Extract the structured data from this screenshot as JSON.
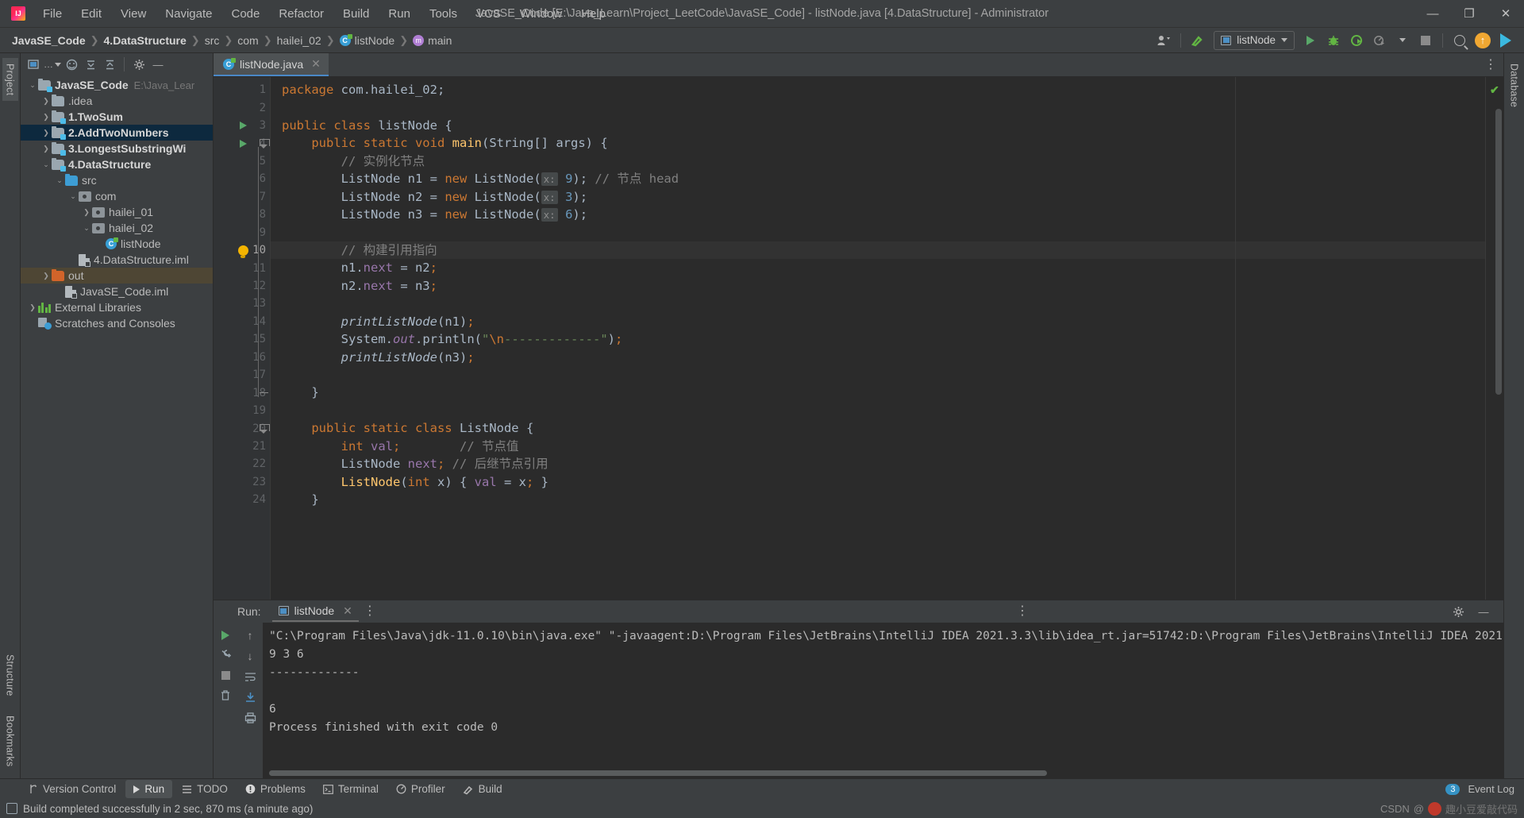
{
  "window": {
    "title": "JavaSE_Code [E:\\Java_Learn\\Project_LeetCode\\JavaSE_Code] - listNode.java [4.DataStructure] - Administrator",
    "minimize": "—",
    "maximize": "❐",
    "close": "✕"
  },
  "menu": [
    "File",
    "Edit",
    "View",
    "Navigate",
    "Code",
    "Refactor",
    "Build",
    "Run",
    "Tools",
    "VCS",
    "Window",
    "Help"
  ],
  "breadcrumbs": [
    {
      "label": "JavaSE_Code",
      "bold": true,
      "icon": ""
    },
    {
      "label": "4.DataStructure",
      "bold": true,
      "icon": ""
    },
    {
      "label": "src",
      "bold": false,
      "icon": ""
    },
    {
      "label": "com",
      "bold": false,
      "icon": ""
    },
    {
      "label": "hailei_02",
      "bold": false,
      "icon": ""
    },
    {
      "label": "listNode",
      "bold": false,
      "icon": "class-icon"
    },
    {
      "label": "main",
      "bold": false,
      "icon": "method-icon"
    }
  ],
  "toolbar": {
    "run_config": "listNode",
    "run_tooltip": "Run",
    "debug_tooltip": "Debug",
    "coverage_tooltip": "Run with Coverage",
    "profile_tooltip": "Profiler",
    "stop_tooltip": "Stop",
    "search_tooltip": "Search Everywhere",
    "update_tooltip": "Update Project"
  },
  "project_panel": {
    "title": "Project",
    "tree": [
      {
        "indent": 0,
        "arrow": "v",
        "icon": "module-folder-icon",
        "label": "JavaSE_Code",
        "bold": true,
        "path": "E:\\Java_Lear",
        "state": "normal"
      },
      {
        "indent": 1,
        "arrow": ">",
        "icon": "folder-icon",
        "label": ".idea",
        "bold": false,
        "path": "",
        "state": "normal"
      },
      {
        "indent": 1,
        "arrow": ">",
        "icon": "module-folder-icon",
        "label": "1.TwoSum",
        "bold": true,
        "path": "",
        "state": "normal"
      },
      {
        "indent": 1,
        "arrow": ">",
        "icon": "module-folder-icon",
        "label": "2.AddTwoNumbers",
        "bold": true,
        "path": "",
        "state": "selected"
      },
      {
        "indent": 1,
        "arrow": ">",
        "icon": "module-folder-icon",
        "label": "3.LongestSubstringWi",
        "bold": true,
        "path": "",
        "state": "normal"
      },
      {
        "indent": 1,
        "arrow": "v",
        "icon": "module-folder-icon",
        "label": "4.DataStructure",
        "bold": true,
        "path": "",
        "state": "normal"
      },
      {
        "indent": 2,
        "arrow": "v",
        "icon": "source-folder-icon",
        "label": "src",
        "bold": false,
        "path": "",
        "state": "normal"
      },
      {
        "indent": 3,
        "arrow": "v",
        "icon": "package-icon",
        "label": "com",
        "bold": false,
        "path": "",
        "state": "normal"
      },
      {
        "indent": 4,
        "arrow": ">",
        "icon": "package-icon",
        "label": "hailei_01",
        "bold": false,
        "path": "",
        "state": "normal"
      },
      {
        "indent": 4,
        "arrow": "v",
        "icon": "package-icon",
        "label": "hailei_02",
        "bold": false,
        "path": "",
        "state": "normal"
      },
      {
        "indent": 5,
        "arrow": "",
        "icon": "class-icon",
        "label": "listNode",
        "bold": false,
        "path": "",
        "state": "normal"
      },
      {
        "indent": 3,
        "arrow": "",
        "icon": "iml-file-icon",
        "label": "4.DataStructure.iml",
        "bold": false,
        "path": "",
        "state": "normal"
      },
      {
        "indent": 1,
        "arrow": ">",
        "icon": "out-folder-icon",
        "label": "out",
        "bold": false,
        "path": "",
        "state": "highlighted"
      },
      {
        "indent": 2,
        "arrow": "",
        "icon": "iml-file-icon",
        "label": "JavaSE_Code.iml",
        "bold": false,
        "path": "",
        "state": "normal"
      },
      {
        "indent": 0,
        "arrow": ">",
        "icon": "library-icon",
        "label": "External Libraries",
        "bold": false,
        "path": "",
        "state": "normal"
      },
      {
        "indent": 0,
        "arrow": "",
        "icon": "scratches-icon",
        "label": "Scratches and Consoles",
        "bold": false,
        "path": "",
        "state": "normal"
      }
    ]
  },
  "left_strip_tabs": [
    "Project"
  ],
  "left_strip_bottom": [
    "Structure",
    "Bookmarks"
  ],
  "right_strip_tabs": [
    "Database"
  ],
  "editor": {
    "tab": {
      "label": "listNode.java",
      "close": "✕"
    },
    "current_line": 10,
    "lines": [
      {
        "n": 1,
        "html": "<span class=\"kw\">package</span> com.hailei_02;",
        "gutter": "",
        "fold": ""
      },
      {
        "n": 2,
        "html": "",
        "gutter": "",
        "fold": ""
      },
      {
        "n": 3,
        "html": "<span class=\"kw\">public class</span> <span class=\"typ\">listNode</span> {",
        "gutter": "run",
        "fold": ""
      },
      {
        "n": 4,
        "html": "    <span class=\"kw\">public static void</span> <span class=\"sm\">main</span>(<span class=\"typ\">String</span>[] args) {",
        "gutter": "run",
        "fold": "minus"
      },
      {
        "n": 5,
        "html": "        <span class=\"cmt\">// 实例化节点</span>",
        "gutter": "",
        "fold": ""
      },
      {
        "n": 6,
        "html": "        <span class=\"typ\">ListNode</span> n1 = <span class=\"kw\">new</span> <span class=\"typ\">ListNode</span>(<span class=\"hint\">x:</span> <span class=\"num\">9</span>); <span class=\"cmt\">// 节点 head</span>",
        "gutter": "",
        "fold": ""
      },
      {
        "n": 7,
        "html": "        <span class=\"typ\">ListNode</span> n2 = <span class=\"kw\">new</span> <span class=\"typ\">ListNode</span>(<span class=\"hint\">x:</span> <span class=\"num\">3</span>);",
        "gutter": "",
        "fold": ""
      },
      {
        "n": 8,
        "html": "        <span class=\"typ\">ListNode</span> n3 = <span class=\"kw\">new</span> <span class=\"typ\">ListNode</span>(<span class=\"hint\">x:</span> <span class=\"num\">6</span>);",
        "gutter": "",
        "fold": ""
      },
      {
        "n": 9,
        "html": "",
        "gutter": "",
        "fold": ""
      },
      {
        "n": 10,
        "html": "        <span class=\"cmt\">// 构建引用指向</span>",
        "gutter": "bulb",
        "fold": ""
      },
      {
        "n": 11,
        "html": "        n1.<span class=\"fld\">next</span> = n2<span class=\"kw\">;</span>",
        "gutter": "",
        "fold": ""
      },
      {
        "n": 12,
        "html": "        n2.<span class=\"fld\">next</span> = n3<span class=\"kw\">;</span>",
        "gutter": "",
        "fold": ""
      },
      {
        "n": 13,
        "html": "",
        "gutter": "",
        "fold": ""
      },
      {
        "n": 14,
        "html": "        <span class=\"ital\">printListNode</span>(n1)<span class=\"kw\">;</span>",
        "gutter": "",
        "fold": ""
      },
      {
        "n": 15,
        "html": "        <span class=\"typ\">System</span>.<span class=\"fld ital\">out</span>.println(<span class=\"str\">\"</span><span class=\"esc\">\\n</span><span class=\"str\">-------------\"</span>)<span class=\"kw\">;</span>",
        "gutter": "",
        "fold": ""
      },
      {
        "n": 16,
        "html": "        <span class=\"ital\">printListNode</span>(n3)<span class=\"kw\">;</span>",
        "gutter": "",
        "fold": ""
      },
      {
        "n": 17,
        "html": "",
        "gutter": "",
        "fold": ""
      },
      {
        "n": 18,
        "html": "    }",
        "gutter": "",
        "fold": "end"
      },
      {
        "n": 19,
        "html": "",
        "gutter": "",
        "fold": ""
      },
      {
        "n": 20,
        "html": "    <span class=\"kw\">public static class</span> <span class=\"typ\">ListNode</span> {",
        "gutter": "",
        "fold": "minus"
      },
      {
        "n": 21,
        "html": "        <span class=\"kw\">int</span> <span class=\"fld\">val</span><span class=\"kw\">;</span>        <span class=\"cmt\">// 节点值</span>",
        "gutter": "",
        "fold": ""
      },
      {
        "n": 22,
        "html": "        <span class=\"typ\">ListNode</span> <span class=\"fld\">next</span><span class=\"kw\">;</span> <span class=\"cmt\">// 后继节点引用</span>",
        "gutter": "",
        "fold": ""
      },
      {
        "n": 23,
        "html": "        <span class=\"sm\">ListNode</span>(<span class=\"kw\">int</span> x) { <span class=\"fld\">val</span> = x<span class=\"kw\">;</span> }",
        "gutter": "",
        "fold": ""
      },
      {
        "n": 24,
        "html": "    }",
        "gutter": "",
        "fold": ""
      }
    ],
    "inspection_status": "✔"
  },
  "run_panel": {
    "label": "Run:",
    "tab": "listNode",
    "tab_close": "✕",
    "console": [
      "\"C:\\Program Files\\Java\\jdk-11.0.10\\bin\\java.exe\" \"-javaagent:D:\\Program Files\\JetBrains\\IntelliJ IDEA 2021.3.3\\lib\\idea_rt.jar=51742:D:\\Program Files\\JetBrains\\IntelliJ IDEA 2021",
      "9 3 6",
      "-------------",
      "",
      "6",
      "Process finished with exit code 0"
    ],
    "settings_tooltip": "Settings",
    "hide_tooltip": "Hide"
  },
  "tool_windows": [
    {
      "label": "Version Control",
      "icon": "branch-icon",
      "active": false
    },
    {
      "label": "Run",
      "icon": "run-icon",
      "active": true
    },
    {
      "label": "TODO",
      "icon": "todo-icon",
      "active": false
    },
    {
      "label": "Problems",
      "icon": "problems-icon",
      "active": false
    },
    {
      "label": "Terminal",
      "icon": "terminal-icon",
      "active": false
    },
    {
      "label": "Profiler",
      "icon": "profiler-icon",
      "active": false
    },
    {
      "label": "Build",
      "icon": "build-icon",
      "active": false
    }
  ],
  "event_log": {
    "label": "Event Log",
    "count": "3"
  },
  "status_bar": {
    "message": "Build completed successfully in 2 sec, 870 ms (a minute ago)"
  },
  "watermark": {
    "prefix": "CSDN",
    "at": "@",
    "name": "趣小豆爱敲代码"
  },
  "colors": {
    "accent": "#4a88c7",
    "keyword": "#cc7832",
    "string": "#6a8759",
    "number": "#6897bb",
    "comment": "#808080",
    "field": "#9876aa",
    "static_method": "#ffc66d",
    "editor_bg": "#2b2b2b",
    "panel_bg": "#3c3f41",
    "selection": "#0d293e",
    "run_green": "#59a869"
  }
}
